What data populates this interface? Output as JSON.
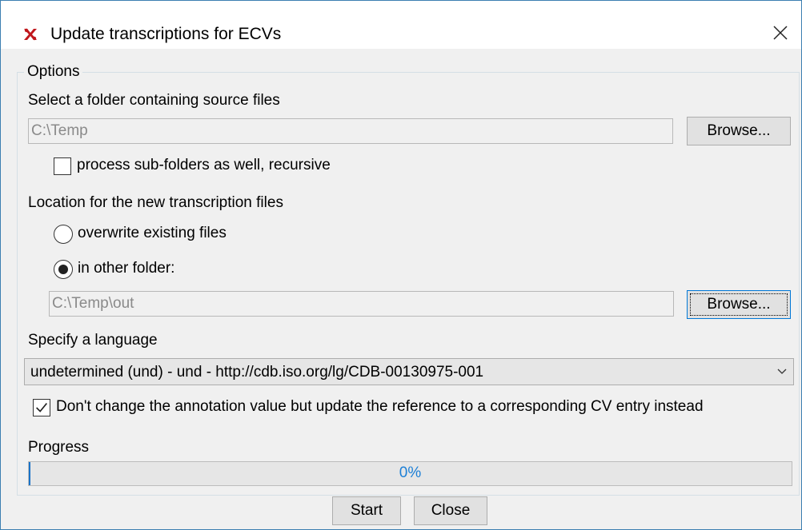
{
  "window": {
    "title": "Update transcriptions for ECVs"
  },
  "options": {
    "legend": "Options",
    "source_label": "Select a folder containing source files",
    "source_path": "C:\\Temp",
    "browse_label": "Browse...",
    "recursive_label": "process sub-folders as well, recursive",
    "recursive_checked": false,
    "location_label": "Location for the new transcription files",
    "overwrite_label": "overwrite existing files",
    "overwrite_selected": false,
    "other_folder_label": "in other folder:",
    "other_folder_selected": true,
    "output_path": "C:\\Temp\\out",
    "browse2_label": "Browse...",
    "language_label": "Specify a language",
    "language_value": "undetermined (und) - und - http://cdb.iso.org/lg/CDB-00130975-001",
    "cv_ref_label": "Don't change the annotation value but update the reference to a corresponding CV entry instead",
    "cv_ref_checked": true,
    "progress_label": "Progress",
    "progress_text": "0%",
    "progress_value": 0
  },
  "buttons": {
    "start": "Start",
    "close": "Close"
  },
  "icons": {
    "app": "elan-x-icon",
    "close": "close-icon",
    "dropdown": "chevron-down-icon",
    "check": "checkmark-icon"
  },
  "colors": {
    "accent": "#0078d7",
    "progress_text": "#1c7fd6",
    "app_icon": "#c0171c"
  }
}
